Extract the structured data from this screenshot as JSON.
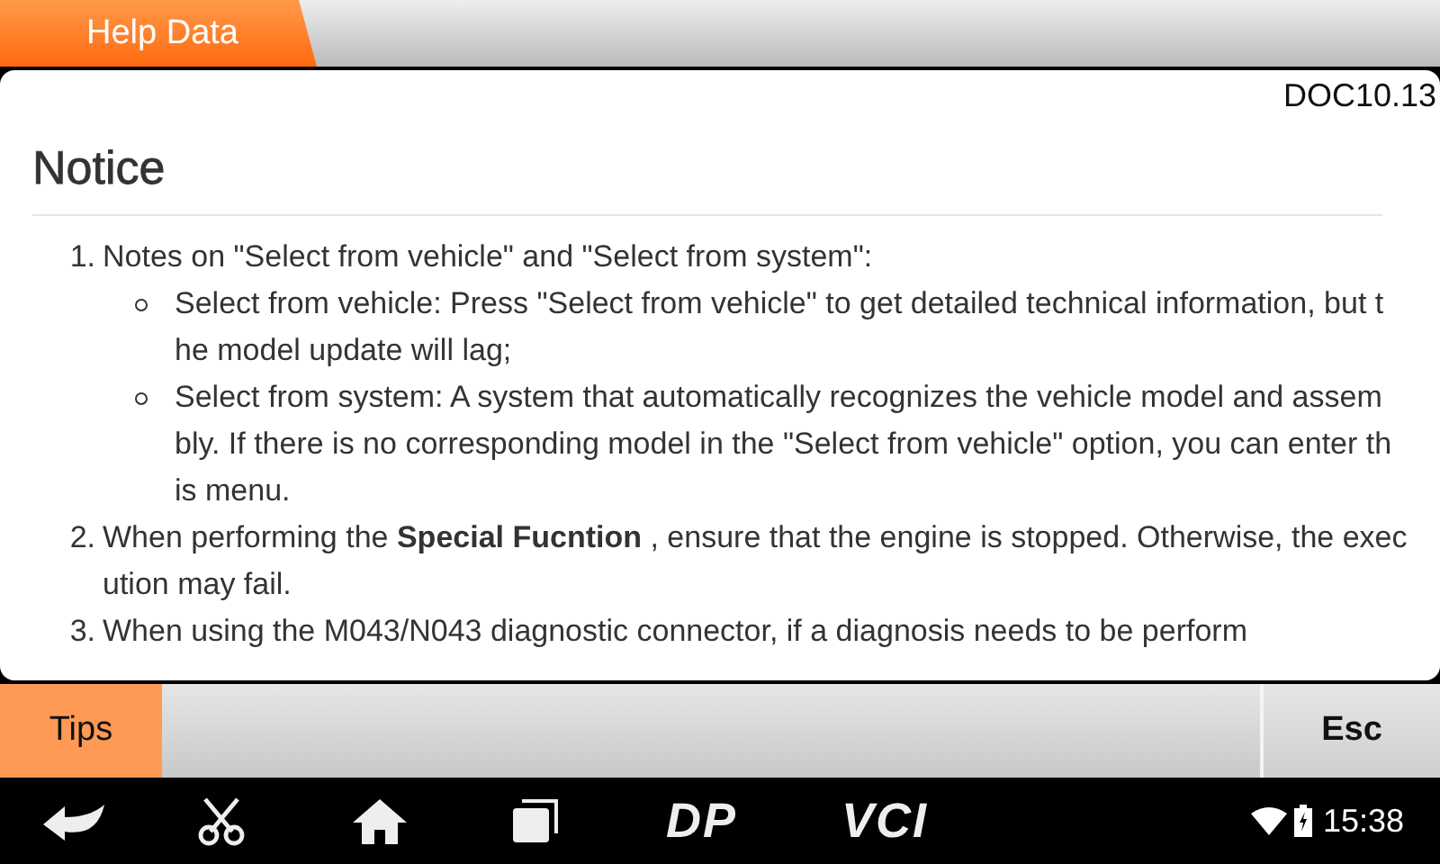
{
  "header": {
    "tab": "Help Data"
  },
  "document": {
    "code": "DOC10.13",
    "title": "Notice",
    "items": [
      {
        "number": "1.",
        "text": "Notes on \"Select from vehicle\" and \"Select from system\":",
        "children": [
          {
            "text": "Select from vehicle: Press \"Select from vehicle\" to get detailed technical information, but the model update will lag;"
          },
          {
            "text": "Select from system: A system that automatically recognizes the vehicle model and assembly. If there is no corresponding model in the \"Select from vehicle\" option, you can enter this menu."
          }
        ]
      },
      {
        "number": "2.",
        "text": "When performing the **Special Fucntion** , ensure that the engine is stopped. Otherwise, the execution may fail."
      },
      {
        "number": "3.",
        "text": "When using the M043/N043 diagnostic connector, if a diagnosis needs to be perform"
      }
    ]
  },
  "footer": {
    "buttons": [
      {
        "label": "Tips",
        "highlighted": true
      },
      {
        "label": "Esc",
        "highlighted": false
      }
    ]
  },
  "nav_bar": {
    "logos": [
      "DP",
      "VCI"
    ],
    "time": "15:38"
  }
}
